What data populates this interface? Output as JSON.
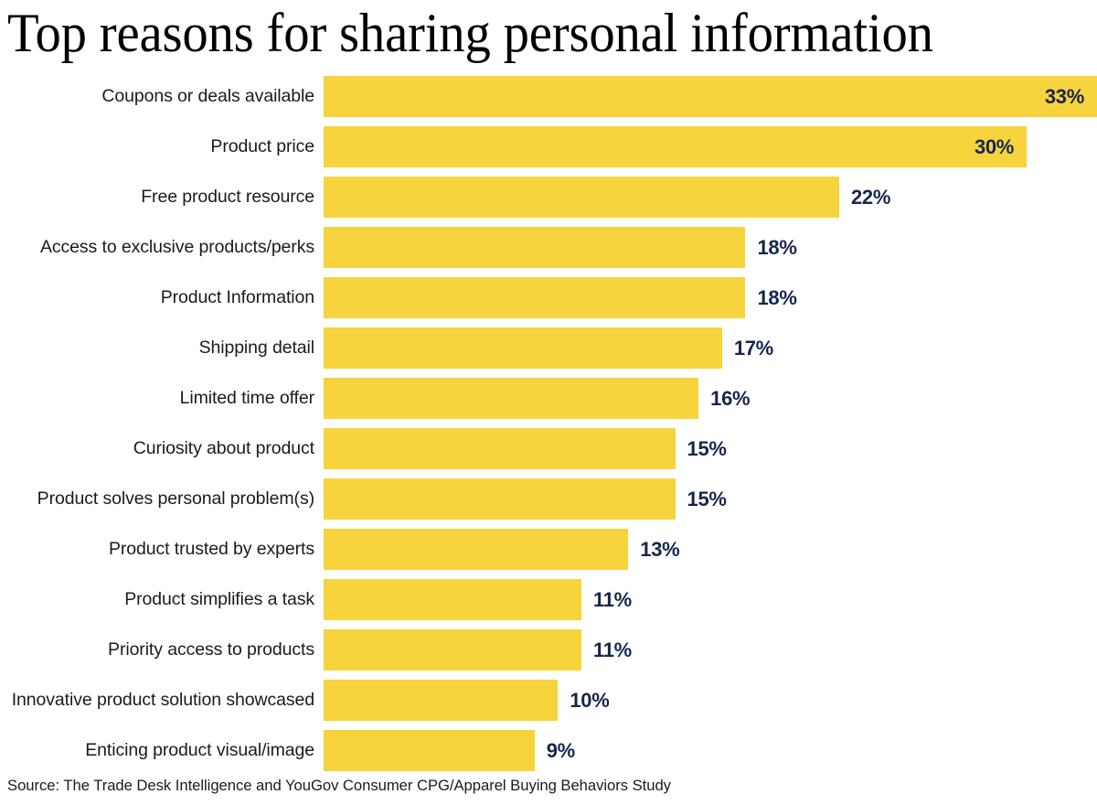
{
  "chart_data": {
    "type": "bar",
    "orientation": "horizontal",
    "title": "Top reasons for sharing personal information",
    "source": "Source: The Trade Desk Intelligence and YouGov Consumer CPG/Apparel Buying Behaviors Study",
    "xlabel": "",
    "ylabel": "",
    "xlim": [
      0,
      33
    ],
    "grid": false,
    "legend": false,
    "bar_color": "#F7D33E",
    "value_label_color": "#16264D",
    "category_label_color": "#1b1b1b",
    "value_suffix": "%",
    "categories": [
      "Coupons or deals available",
      "Product price",
      "Free product resource",
      "Access to exclusive products/perks",
      "Product Information",
      "Shipping detail",
      "Limited time offer",
      "Curiosity about product",
      "Product solves personal problem(s)",
      "Product trusted by experts",
      "Product simplifies a task",
      "Priority access to products",
      "Innovative product solution showcased",
      "Enticing product visual/image"
    ],
    "values": [
      33,
      30,
      22,
      18,
      18,
      17,
      16,
      15,
      15,
      13,
      11,
      11,
      10,
      9
    ],
    "value_labels": [
      "33%",
      "30%",
      "22%",
      "18%",
      "18%",
      "17%",
      "16%",
      "15%",
      "15%",
      "13%",
      "11%",
      "11%",
      "10%",
      "9%"
    ],
    "label_placement": [
      "inside",
      "inside",
      "outside",
      "outside",
      "outside",
      "outside",
      "outside",
      "outside",
      "outside",
      "outside",
      "outside",
      "outside",
      "outside",
      "outside"
    ]
  }
}
